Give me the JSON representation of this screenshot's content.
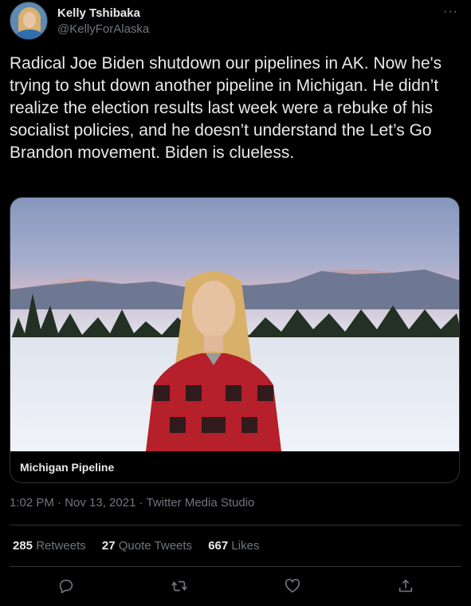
{
  "author": {
    "name": "Kelly Tshibaka",
    "handle": "@KellyForAlaska"
  },
  "more_label": "···",
  "tweet": {
    "text": "Radical Joe Biden shutdown our pipelines in AK. Now he's trying to shut down another pipeline in Michigan. He didn’t realize the election results last week were a rebuke of his socialist policies, and he doesn’t understand the Let’s Go Brandon movement. Biden is clueless."
  },
  "media": {
    "caption": "Michigan Pipeline"
  },
  "meta": {
    "timestamp": "1:02 PM · Nov 13, 2021 · Twitter Media Studio"
  },
  "stats": {
    "retweets_count": "285",
    "retweets_label": "Retweets",
    "quotes_count": "27",
    "quotes_label": "Quote Tweets",
    "likes_count": "667",
    "likes_label": "Likes"
  },
  "actions": [
    {
      "icon": "reply-icon"
    },
    {
      "icon": "retweet-icon"
    },
    {
      "icon": "like-icon"
    },
    {
      "icon": "share-icon"
    }
  ],
  "colors": {
    "background": "#000000",
    "primary_text": "#e7e9ea",
    "secondary_text": "#71767b",
    "border": "#2f3336"
  }
}
